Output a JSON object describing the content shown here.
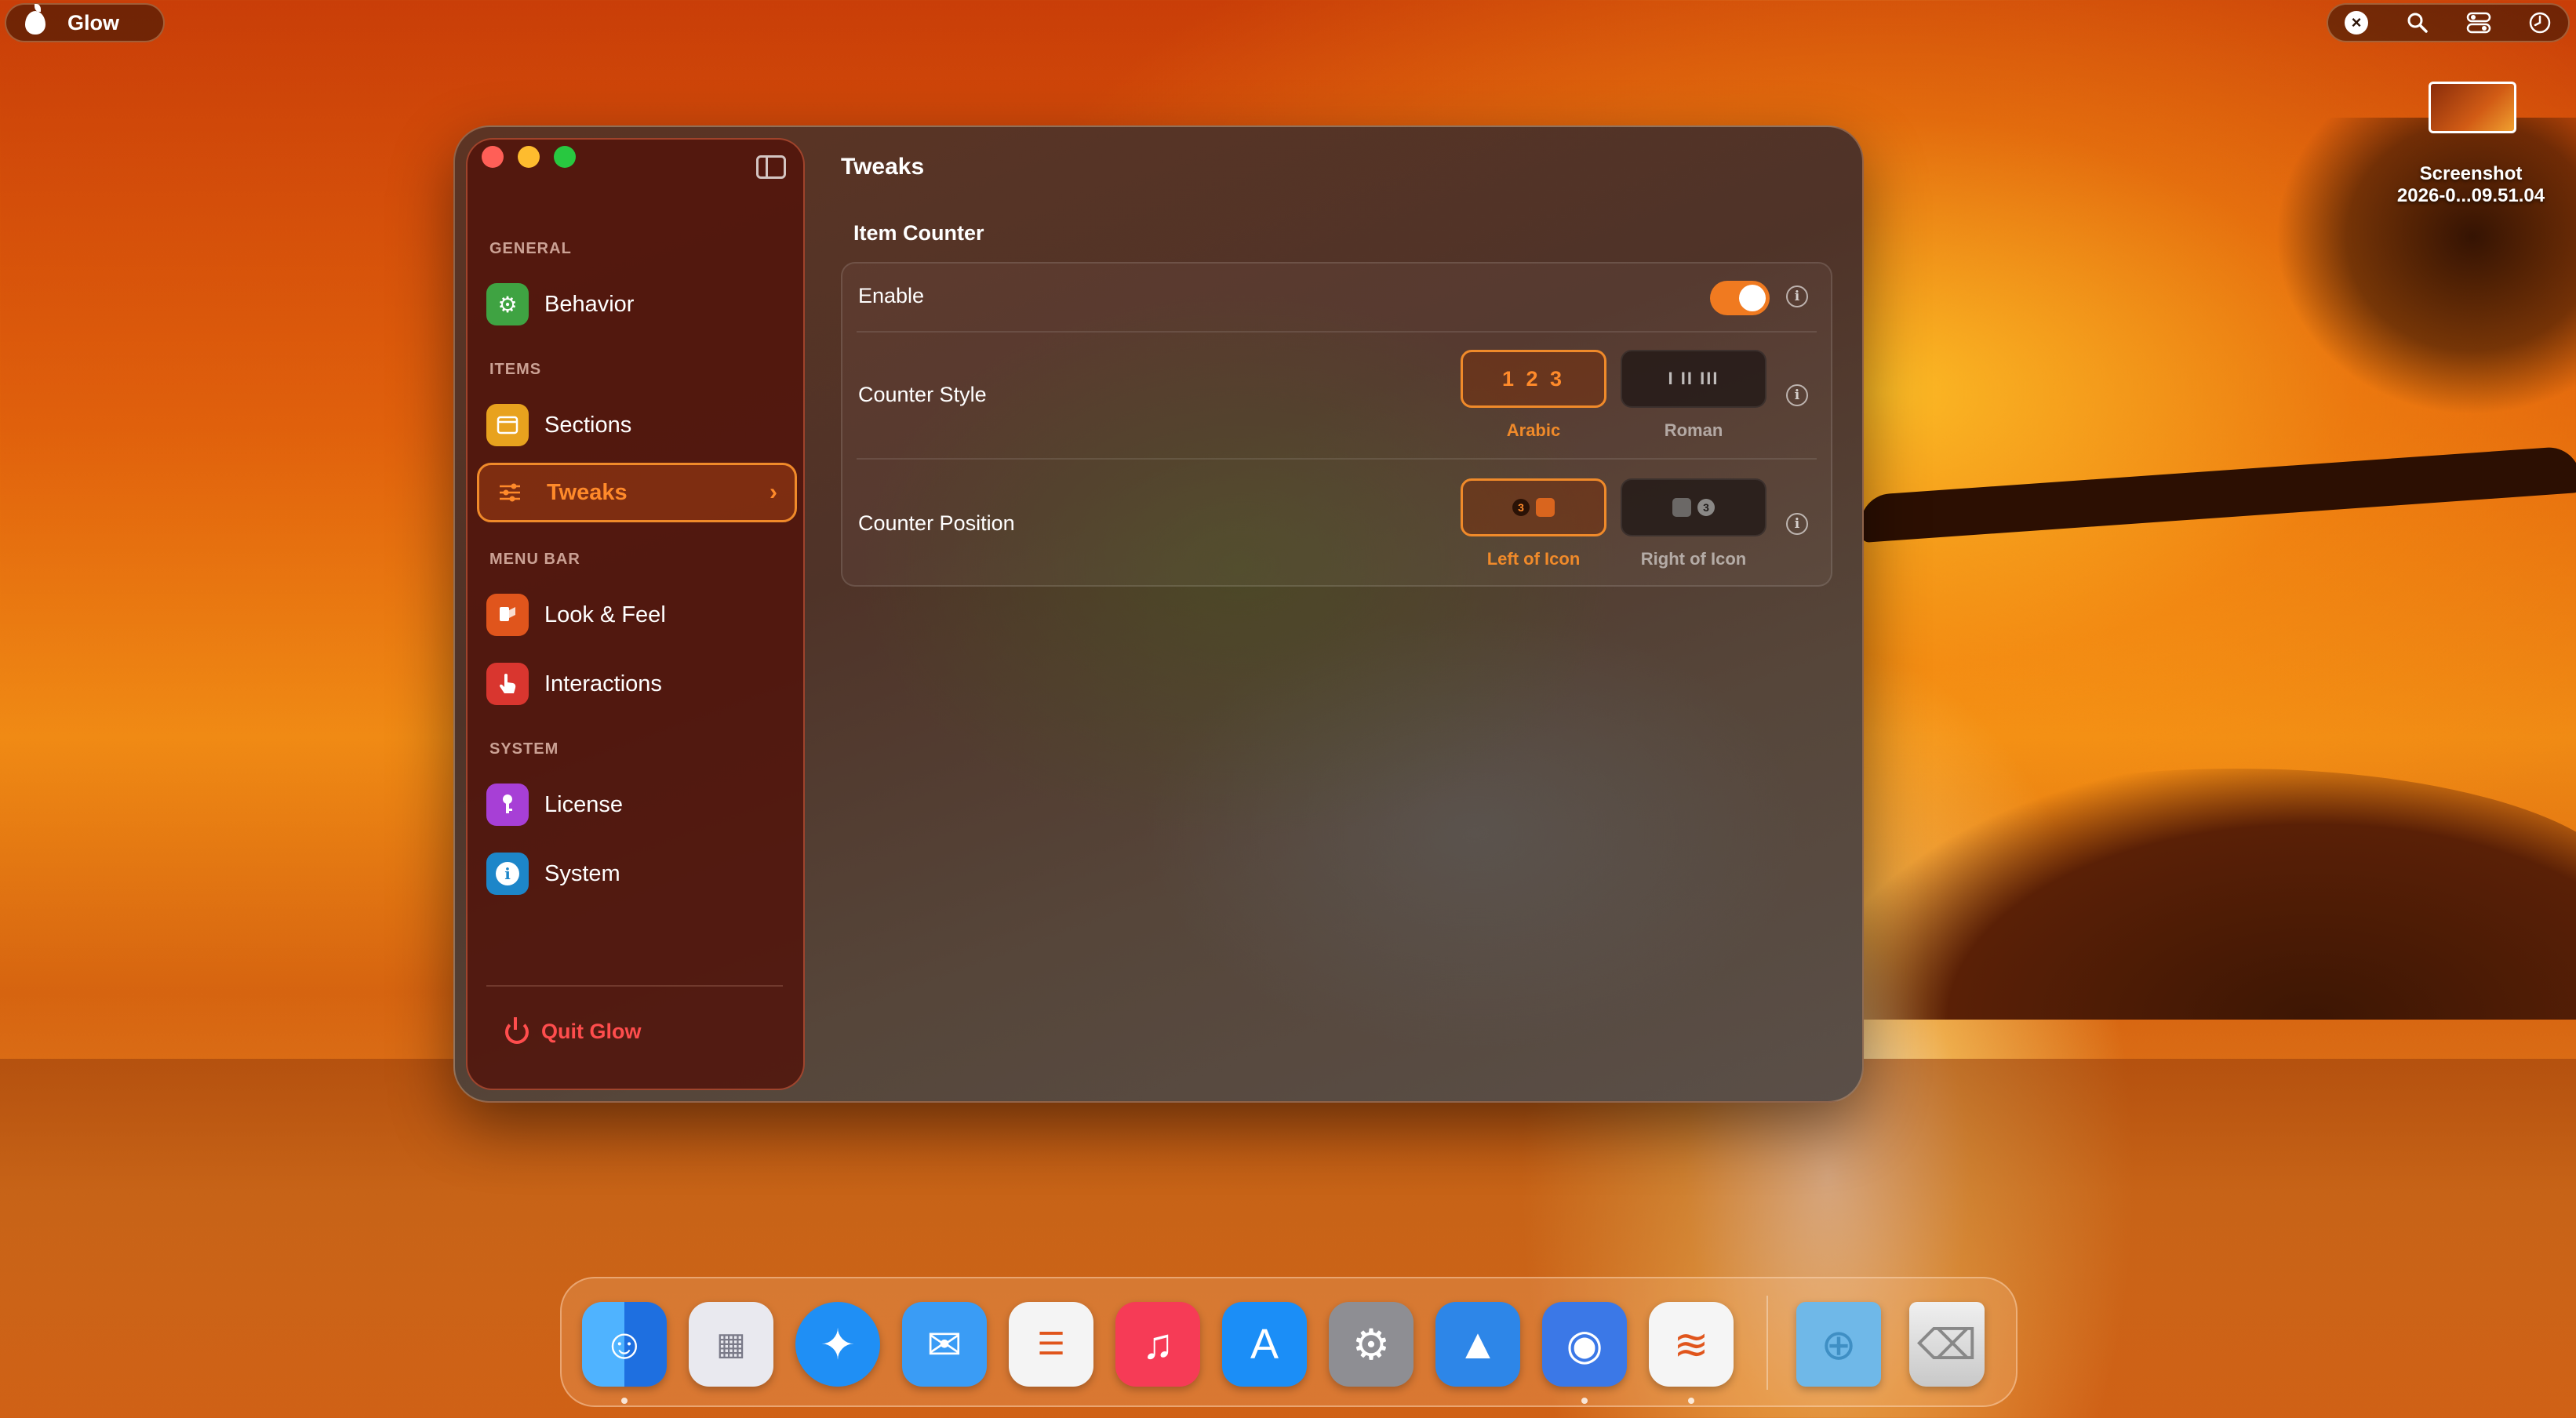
{
  "menubar": {
    "app_name": "Glow",
    "status_icons": [
      "close-icon",
      "search-icon",
      "control-center-icon",
      "clock-icon"
    ]
  },
  "desktop": {
    "file_name_line1": "Screenshot",
    "file_name_line2": "2026-0...09.51.04"
  },
  "window": {
    "sidebar": {
      "sections": [
        {
          "header": "GENERAL",
          "items": [
            {
              "label": "Behavior",
              "icon": "gear-icon",
              "color": "#3fa342"
            }
          ]
        },
        {
          "header": "ITEMS",
          "items": [
            {
              "label": "Sections",
              "icon": "window-icon",
              "color": "#e8a21e"
            },
            {
              "label": "Tweaks",
              "icon": "sliders-icon",
              "color": "#f08a2a",
              "selected": true
            }
          ]
        },
        {
          "header": "MENU BAR",
          "items": [
            {
              "label": "Look & Feel",
              "icon": "brush-icon",
              "color": "#e0551c"
            },
            {
              "label": "Interactions",
              "icon": "hand-pointer-icon",
              "color": "#d9362f"
            }
          ]
        },
        {
          "header": "SYSTEM",
          "items": [
            {
              "label": "License",
              "icon": "key-icon",
              "color": "#a73fd6"
            },
            {
              "label": "System",
              "icon": "info-icon",
              "color": "#1d86c9"
            }
          ]
        }
      ],
      "quit_label": "Quit Glow"
    },
    "page_title": "Tweaks",
    "group_title": "Item Counter",
    "rows": {
      "enable": {
        "label": "Enable",
        "enabled": true
      },
      "counter_style": {
        "label": "Counter Style",
        "options": [
          {
            "glyph": "1 2 3",
            "caption": "Arabic",
            "selected": true
          },
          {
            "glyph": "I II III",
            "caption": "Roman",
            "selected": false
          }
        ]
      },
      "counter_position": {
        "label": "Counter Position",
        "options": [
          {
            "badge": "3",
            "caption": "Left of Icon",
            "selected": true
          },
          {
            "badge": "3",
            "caption": "Right of Icon",
            "selected": false
          }
        ]
      }
    },
    "accent_color": "#f08a2a"
  },
  "dock": {
    "apps": [
      {
        "name": "finder-icon",
        "color": "#2e8ef0",
        "running": true
      },
      {
        "name": "launchpad-icon",
        "color": "#e9e9ef",
        "running": false
      },
      {
        "name": "safari-icon",
        "color": "#1f8ff5",
        "running": false
      },
      {
        "name": "mail-icon",
        "color": "#3a9cf5",
        "running": false
      },
      {
        "name": "reminders-icon",
        "color": "#f4f4f4",
        "running": false
      },
      {
        "name": "music-icon",
        "color": "#f63b56",
        "running": false
      },
      {
        "name": "app-store-icon",
        "color": "#1b8ef7",
        "running": false
      },
      {
        "name": "system-settings-icon",
        "color": "#8e8e93",
        "running": false
      },
      {
        "name": "mountain-app-icon",
        "color": "#2d86e8",
        "running": false
      },
      {
        "name": "preview-app-icon",
        "color": "#3b78e7",
        "running": true
      },
      {
        "name": "glow-app-icon",
        "color": "#f5f5f5",
        "running": true
      }
    ],
    "stack_icons": [
      "downloads-folder-icon",
      "trash-icon"
    ]
  }
}
